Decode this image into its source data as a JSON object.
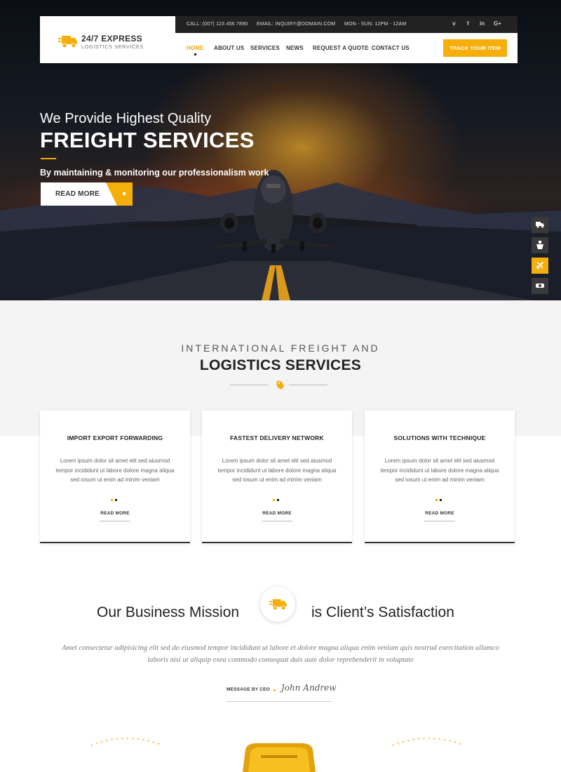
{
  "header": {
    "logo_title": "24/7 EXPRESS",
    "logo_subtitle": "LOGISTICS SERVICES",
    "logo_icon": "truck-icon",
    "topbar": {
      "call": "CALL: (007) 123 456 7890",
      "email": "EMAIL: INQUIRY@DOMAIN.COM",
      "hours": "MON - SUN: 12PM - 12AM",
      "social": [
        {
          "icon": "twitter-icon",
          "glyph": "y"
        },
        {
          "icon": "facebook-icon",
          "glyph": "f"
        },
        {
          "icon": "linkedin-icon",
          "glyph": "in"
        },
        {
          "icon": "google-plus-icon",
          "glyph": "G+"
        }
      ]
    },
    "nav": [
      "HOME",
      "ABOUT US",
      "SERVICES",
      "NEWS",
      "REQUEST A QUOTE",
      "CONTACT US"
    ],
    "active_nav": "HOME",
    "track_button": "TRACK YOUR ITEM"
  },
  "hero": {
    "line1": "We Provide Highest Quality",
    "line2": "FREIGHT SERVICES",
    "line3": "By maintaining & monitoring our professionalism work",
    "button": "READ MORE",
    "side_icons": [
      {
        "icon": "truck-icon",
        "glyph": "⛟",
        "active": false
      },
      {
        "icon": "ship-icon",
        "glyph": "⚓",
        "active": false
      },
      {
        "icon": "plane-icon",
        "glyph": "✈",
        "active": true
      },
      {
        "icon": "train-icon",
        "glyph": "◙",
        "active": false
      }
    ]
  },
  "services": {
    "kicker": "INTERNATIONAL FREIGHT AND",
    "title": "LOGISTICS SERVICES",
    "cards": [
      {
        "title": "IMPORT EXPORT FORWARDING",
        "text": "Lorem ipsum dolor sit amet elit sed aiusmod tempor incididunt ut labore dolore magna aliqua sed iosum ut enim ad minim veniam",
        "link": "READ MORE"
      },
      {
        "title": "FASTEST DELIVERY NETWORK",
        "text": "Lorem ipsum dolor sit amet elit sed aiusmod tempor incididunt ut labore dolore magna aliqua sed iosum ut enim ad minim veniam",
        "link": "READ MORE"
      },
      {
        "title": "SOLUTIONS WITH TECHNIQUE",
        "text": "Lorem ipsum dolor sit amet elit sed aiusmod tempor incididunt ut labore dolore magna aliqua sed iosum ut enim ad minim veniam",
        "link": "READ MORE"
      }
    ]
  },
  "mission": {
    "left": "Our Business Mission",
    "right": "is Client’s Satisfaction",
    "text": "Amet consectetur adipisicing elit sed do eiusmod tempor incididunt ut labore et dolore magna aliqua enim veniam quis nostrud exercitation ullamco laboris nisi ut aliquip exea commodo consequat duis aute dolor reprehenderit in voluptate",
    "ceo_label": "MESSAGE BY CEO",
    "ceo_signature": "John Andrew"
  },
  "colors": {
    "accent": "#f5ae0a",
    "dark": "#222222"
  }
}
